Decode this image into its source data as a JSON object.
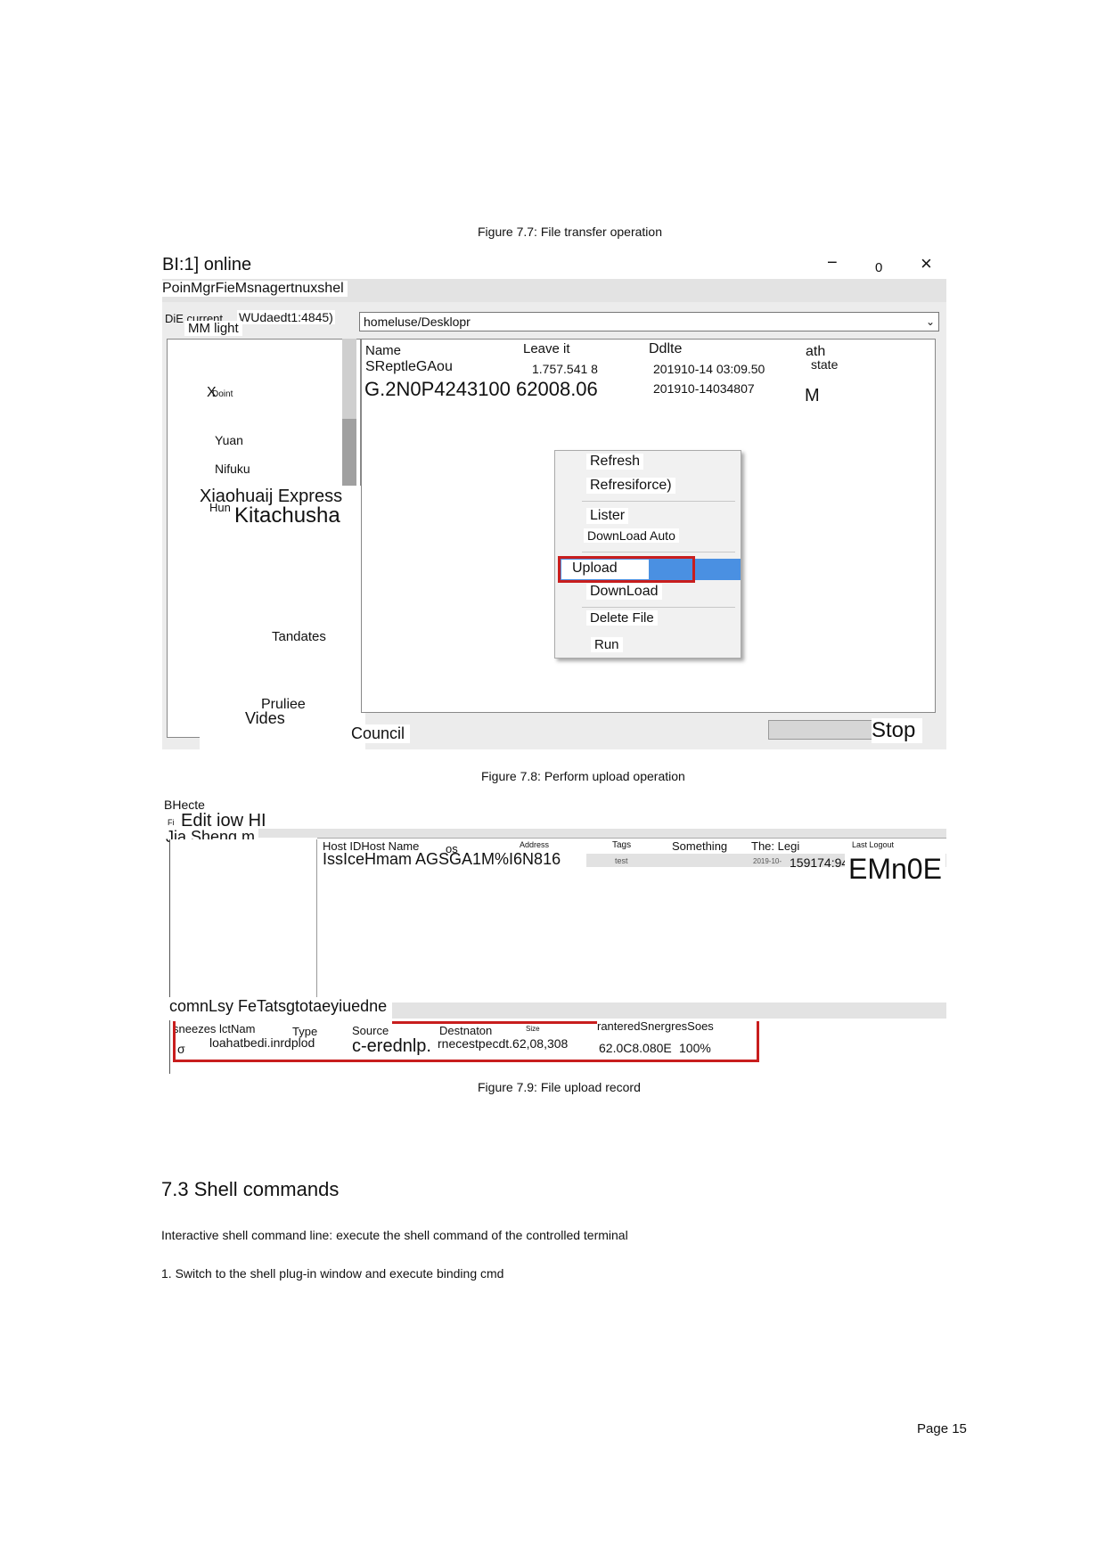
{
  "fig77": {
    "caption": "Figure 7.7: File transfer operation"
  },
  "win1": {
    "title": "BI:1] online",
    "controls": {
      "minimize": "−",
      "maximize": "0",
      "close": "×"
    },
    "toolbar": "PoinMgrFieMsnagertnuxshel",
    "path_label": "DiE current",
    "path_label2": "WUdaedt1:4845)",
    "path_sub": "MM light",
    "path_value": "homeluse/Desklopr",
    "tree": [
      "X",
      "Yuan",
      "Nifuku",
      "Xiaohuaij Express",
      "Hun",
      "Kitachusha",
      "Tandates",
      "Pruliee",
      "Vides"
    ],
    "tree_extra": "Doint",
    "file_headers": {
      "name": "Name",
      "size": "Leave it",
      "date": "Ddlte",
      "attr": "ath",
      "state": "state"
    },
    "files": [
      {
        "name": "SReptleGAou",
        "size": "1.757.541 8",
        "date": "201910-14 03:09.50",
        "attr": ""
      },
      {
        "name": "G.2N0P4243100 62008.06",
        "size": "",
        "date": "201910-14034807",
        "attr": "M"
      }
    ],
    "context_menu": [
      "Refresh",
      "Refresiforce)",
      "Lister",
      "DownLoad Auto",
      "Upload",
      "DownLoad",
      "Delete File",
      "Run"
    ],
    "footer_left": "Council",
    "footer_right": "Stop"
  },
  "fig78": {
    "caption": "Figure 7.8: Perform upload operation"
  },
  "win2": {
    "title": "BHecte",
    "menu_prefix": "Fi",
    "menu": "Edit iow HI",
    "tree_label": "Jia Sheng m",
    "headers": [
      "Host IDHost Name",
      "os",
      "Address",
      "Tags",
      "Something",
      "The: Legi",
      "Last Logout"
    ],
    "row": {
      "host": "IssIceHmam AGSGA1M%I6N816",
      "tags": "test",
      "date_small": "2019-10-",
      "date": "159174:94",
      "big": "EMn0E"
    },
    "tabs": "comnLsy FeTatsgtotaeyiuedne",
    "record_headers": {
      "a": "sneezes lctNam",
      "b": "Type",
      "c": "Source",
      "d": "Destnaton",
      "e": "Size",
      "f": "ranteredSnergresSoes"
    },
    "record_row": {
      "icon": "σ",
      "a": "loahatbedi.inrdplod",
      "c": "c-erednlp.",
      "d": "rnecestpecdt.62,08,308",
      "f1": "62.0C8.080E",
      "f2": "100%"
    }
  },
  "fig79": {
    "caption": "Figure 7.9: File upload record"
  },
  "section": {
    "heading": "7.3 Shell commands",
    "para1": "Interactive shell command line: execute the shell command of the controlled terminal",
    "para2": "1. Switch to the shell plug-in window and execute binding cmd"
  },
  "footer": {
    "page": "Page 15"
  },
  "colors": {
    "highlight": "#4a90e2",
    "red_frame": "#c81e1e"
  }
}
